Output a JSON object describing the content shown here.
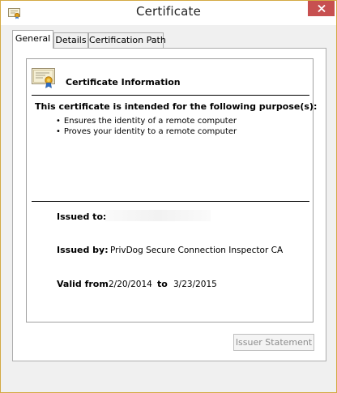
{
  "window": {
    "title": "Certificate",
    "title_icon": "certificate-icon",
    "close_icon": "close-icon",
    "close_color": "#c75050"
  },
  "tabs": [
    {
      "label": "General",
      "active": true
    },
    {
      "label": "Details",
      "active": false
    },
    {
      "label": "Certification Path",
      "active": false
    }
  ],
  "general": {
    "info_title": "Certificate Information",
    "info_icon": "certificate-icon",
    "purpose_heading": "This certificate is intended for the following purpose(s):",
    "purposes": [
      "Ensures the identity of a remote computer",
      "Proves your identity to a remote computer"
    ],
    "issued_to_label": "Issued to:",
    "issued_to_value": "",
    "issued_by_label": "Issued by:",
    "issued_by_value": "PrivDog Secure Connection Inspector CA",
    "valid_from_label": "Valid from",
    "valid_from_value": "2/20/2014",
    "to_label": "to",
    "valid_to_value": "3/23/2015",
    "issuer_statement_label": "Issuer Statement",
    "issuer_statement_enabled": false
  }
}
